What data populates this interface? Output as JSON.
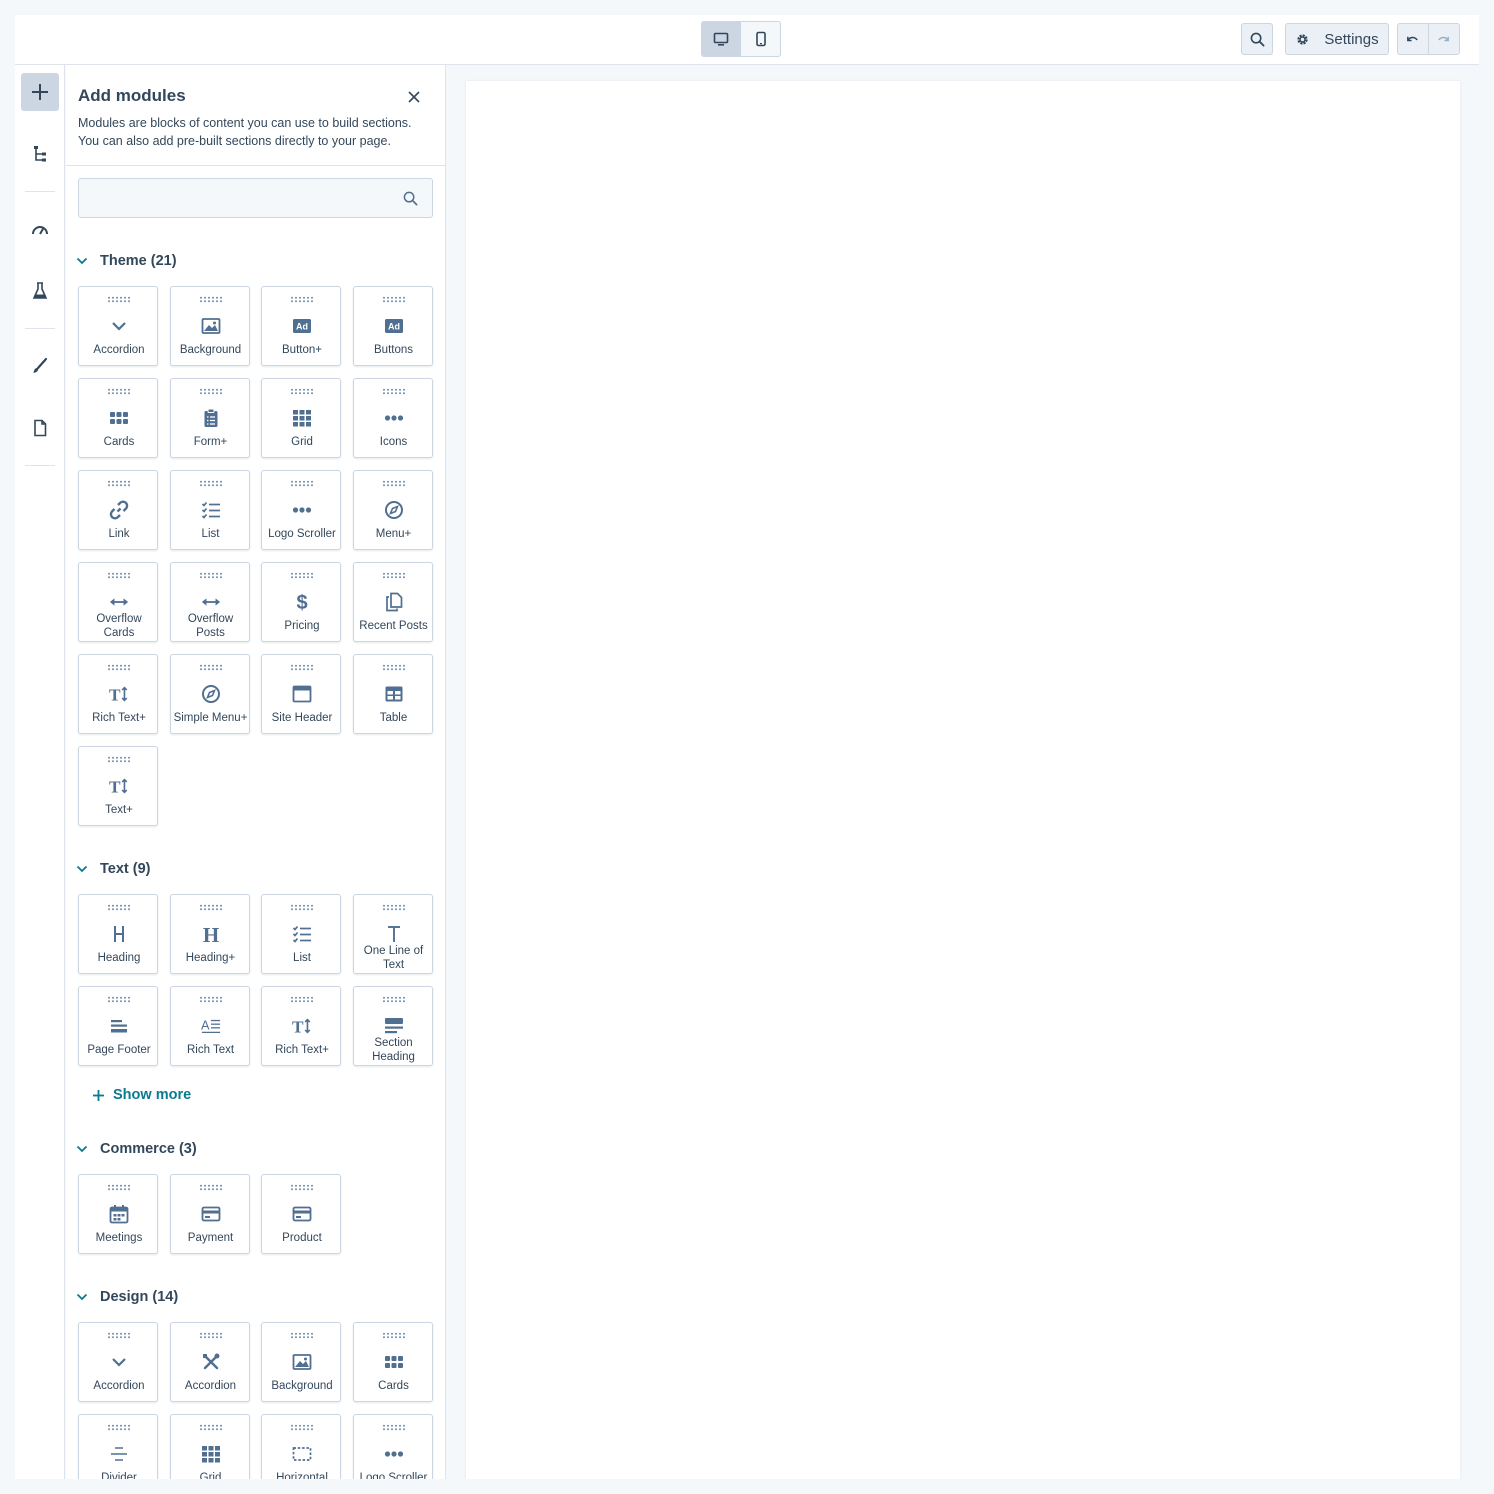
{
  "toolbar": {
    "settings_label": "Settings",
    "device_desktop_icon": "desktop-icon",
    "device_mobile_icon": "mobile-icon"
  },
  "panel": {
    "title": "Add modules",
    "description": "Modules are blocks of content you can use to build sections. You can also add pre-built sections directly to your page.",
    "search_placeholder": ""
  },
  "sections": {
    "theme": {
      "label": "Theme (21)",
      "tiles": [
        {
          "label": "Accordion",
          "icon": "chevron-down-icon"
        },
        {
          "label": "Background",
          "icon": "image-icon"
        },
        {
          "label": "Button+",
          "icon": "ad-icon"
        },
        {
          "label": "Buttons",
          "icon": "ad-icon"
        },
        {
          "label": "Cards",
          "icon": "cards-icon"
        },
        {
          "label": "Form+",
          "icon": "form-icon"
        },
        {
          "label": "Grid",
          "icon": "grid-icon"
        },
        {
          "label": "Icons",
          "icon": "dots-icon"
        },
        {
          "label": "Link",
          "icon": "link-icon"
        },
        {
          "label": "List",
          "icon": "checklist-icon"
        },
        {
          "label": "Logo Scroller",
          "icon": "dots-icon"
        },
        {
          "label": "Menu+",
          "icon": "compass-icon"
        },
        {
          "label": "Overflow Cards",
          "icon": "arrows-horizontal-icon"
        },
        {
          "label": "Overflow Posts",
          "icon": "arrows-horizontal-icon"
        },
        {
          "label": "Pricing",
          "icon": "dollar-icon"
        },
        {
          "label": "Recent Posts",
          "icon": "copy-icon"
        },
        {
          "label": "Rich Text+",
          "icon": "text-size-icon"
        },
        {
          "label": "Simple Menu+",
          "icon": "compass-icon"
        },
        {
          "label": "Site Header",
          "icon": "window-icon"
        },
        {
          "label": "Table",
          "icon": "table-icon"
        },
        {
          "label": "Text+",
          "icon": "text-size-icon"
        }
      ]
    },
    "text": {
      "label": "Text (9)",
      "tiles": [
        {
          "label": "Heading",
          "icon": "heading-icon"
        },
        {
          "label": "Heading+",
          "icon": "heading-bold-icon"
        },
        {
          "label": "List",
          "icon": "checklist-icon"
        },
        {
          "label": "One Line of Text",
          "icon": "text-t-icon"
        },
        {
          "label": "Page Footer",
          "icon": "footer-icon"
        },
        {
          "label": "Rich Text",
          "icon": "rich-text-icon"
        },
        {
          "label": "Rich Text+",
          "icon": "text-size-icon"
        },
        {
          "label": "Section Heading",
          "icon": "section-heading-icon"
        }
      ],
      "show_more": "Show more"
    },
    "commerce": {
      "label": "Commerce (3)",
      "tiles": [
        {
          "label": "Meetings",
          "icon": "calendar-icon"
        },
        {
          "label": "Payment",
          "icon": "credit-card-icon"
        },
        {
          "label": "Product",
          "icon": "credit-card-icon"
        }
      ]
    },
    "design": {
      "label": "Design (14)",
      "tiles": [
        {
          "label": "Accordion",
          "icon": "chevron-down-icon"
        },
        {
          "label": "Accordion",
          "icon": "tools-icon"
        },
        {
          "label": "Background",
          "icon": "image-icon"
        },
        {
          "label": "Cards",
          "icon": "cards-icon"
        },
        {
          "label": "Divider",
          "icon": "divider-icon"
        },
        {
          "label": "Grid",
          "icon": "grid-icon"
        },
        {
          "label": "Horizontal",
          "icon": "dashed-box-icon"
        },
        {
          "label": "Logo Scroller",
          "icon": "dots-icon"
        }
      ]
    }
  },
  "colors": {
    "icon": "#516f90",
    "accent_link": "#0b7a8f",
    "border": "#cbd6e2",
    "text": "#33475b"
  }
}
